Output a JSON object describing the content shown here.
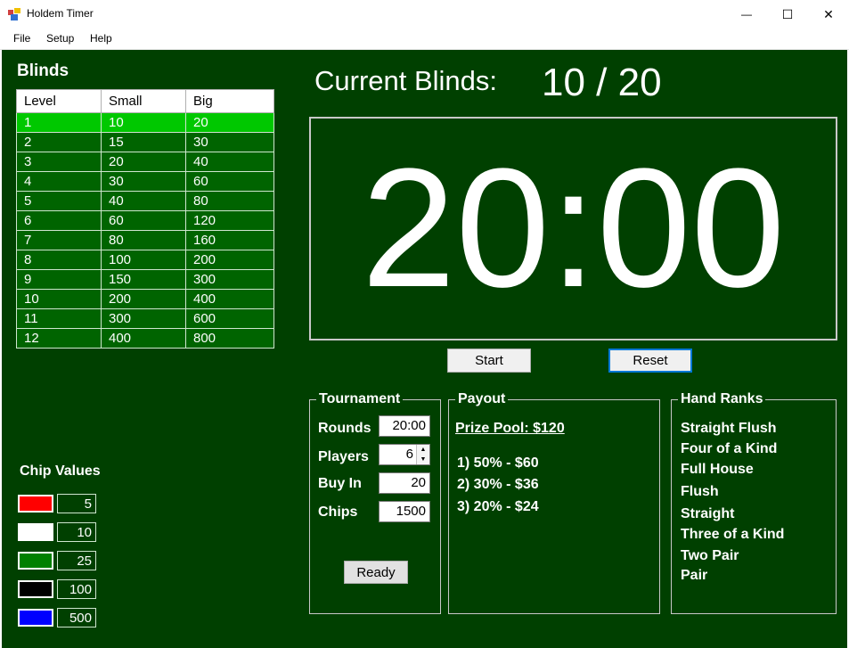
{
  "window": {
    "title": "Holdem Timer",
    "minimize_label": "—",
    "maximize_label": "☐",
    "close_label": "✕"
  },
  "menu": [
    {
      "label": "File"
    },
    {
      "label": "Setup"
    },
    {
      "label": "Help"
    }
  ],
  "blinds": {
    "title": "Blinds",
    "columns": [
      "Level",
      "Small",
      "Big"
    ],
    "selected_level": "1",
    "rows": [
      [
        "1",
        "10",
        "20"
      ],
      [
        "2",
        "15",
        "30"
      ],
      [
        "3",
        "20",
        "40"
      ],
      [
        "4",
        "30",
        "60"
      ],
      [
        "5",
        "40",
        "80"
      ],
      [
        "6",
        "60",
        "120"
      ],
      [
        "7",
        "80",
        "160"
      ],
      [
        "8",
        "100",
        "200"
      ],
      [
        "9",
        "150",
        "300"
      ],
      [
        "10",
        "200",
        "400"
      ],
      [
        "11",
        "300",
        "600"
      ],
      [
        "12",
        "400",
        "800"
      ]
    ]
  },
  "chips": {
    "title": "Chip Values",
    "items": [
      {
        "color": "#ff0000",
        "value": "5"
      },
      {
        "color": "#ffffff",
        "value": "10"
      },
      {
        "color": "#008000",
        "value": "25"
      },
      {
        "color": "#000000",
        "value": "100"
      },
      {
        "color": "#0000ff",
        "value": "500"
      }
    ]
  },
  "current_blinds": {
    "label": "Current Blinds:",
    "value": "10 / 20"
  },
  "timer": {
    "display": "20:00"
  },
  "controls": {
    "start_label": "Start",
    "reset_label": "Reset"
  },
  "tournament": {
    "title": "Tournament",
    "rounds_label": "Rounds",
    "rounds_value": "20:00",
    "players_label": "Players",
    "players_value": "6",
    "buyin_label": "Buy In",
    "buyin_value": "20",
    "chips_label": "Chips",
    "chips_value": "1500",
    "ready_label": "Ready"
  },
  "payout": {
    "title": "Payout",
    "prize_pool": "Prize Pool:  $120",
    "places": [
      "1) 50%  - $60",
      "2) 30%  - $36",
      "3) 20%  - $24"
    ]
  },
  "hand_ranks": {
    "title": "Hand Ranks",
    "items": [
      "Straight Flush",
      "Four of a Kind",
      "Full House",
      "Flush",
      "Straight",
      "Three of a Kind",
      "Two Pair",
      "Pair"
    ]
  },
  "colors": {
    "background": "#004000",
    "row": "#006400",
    "selected_row": "#00c800"
  }
}
